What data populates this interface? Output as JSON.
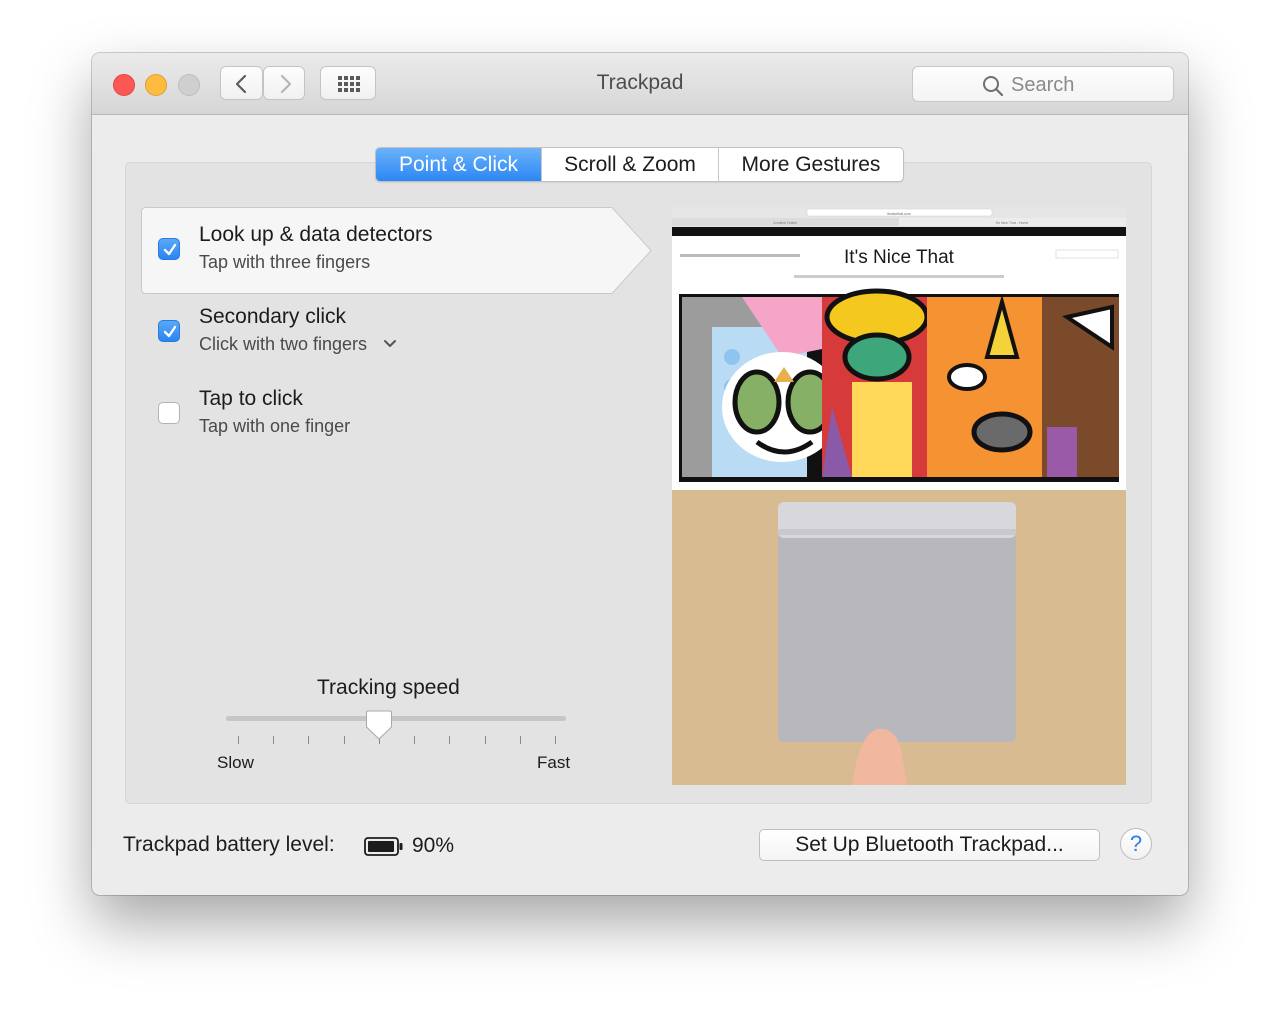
{
  "window": {
    "title": "Trackpad"
  },
  "toolbar": {
    "search_placeholder": "Search",
    "back_icon": "chevron-left-icon",
    "forward_icon": "chevron-right-icon",
    "grid_icon": "grid-icon"
  },
  "tabs": [
    {
      "label": "Point & Click",
      "active": true
    },
    {
      "label": "Scroll & Zoom",
      "active": false
    },
    {
      "label": "More Gestures",
      "active": false
    }
  ],
  "options": [
    {
      "title": "Look up & data detectors",
      "subtitle": "Tap with three fingers",
      "checked": true,
      "selected": true
    },
    {
      "title": "Secondary click",
      "subtitle": "Click with two fingers",
      "checked": true,
      "has_dropdown": true
    },
    {
      "title": "Tap to click",
      "subtitle": "Tap with one finger",
      "checked": false
    }
  ],
  "tracking": {
    "label": "Tracking speed",
    "min_label": "Slow",
    "max_label": "Fast",
    "value": 0.45,
    "ticks": 10
  },
  "preview_site": {
    "name": "It's Nice That",
    "url": "itsnicethat.com",
    "tab_left": "Creative Online",
    "tab_right": "It's Nice That - Home"
  },
  "battery": {
    "label": "Trackpad battery level:",
    "value": "90%"
  },
  "buttons": {
    "setup": "Set Up Bluetooth Trackpad...",
    "help": "?"
  },
  "colors": {
    "accent": "#2c86f4",
    "close": "#fc5753",
    "minimize": "#fdbc40"
  }
}
